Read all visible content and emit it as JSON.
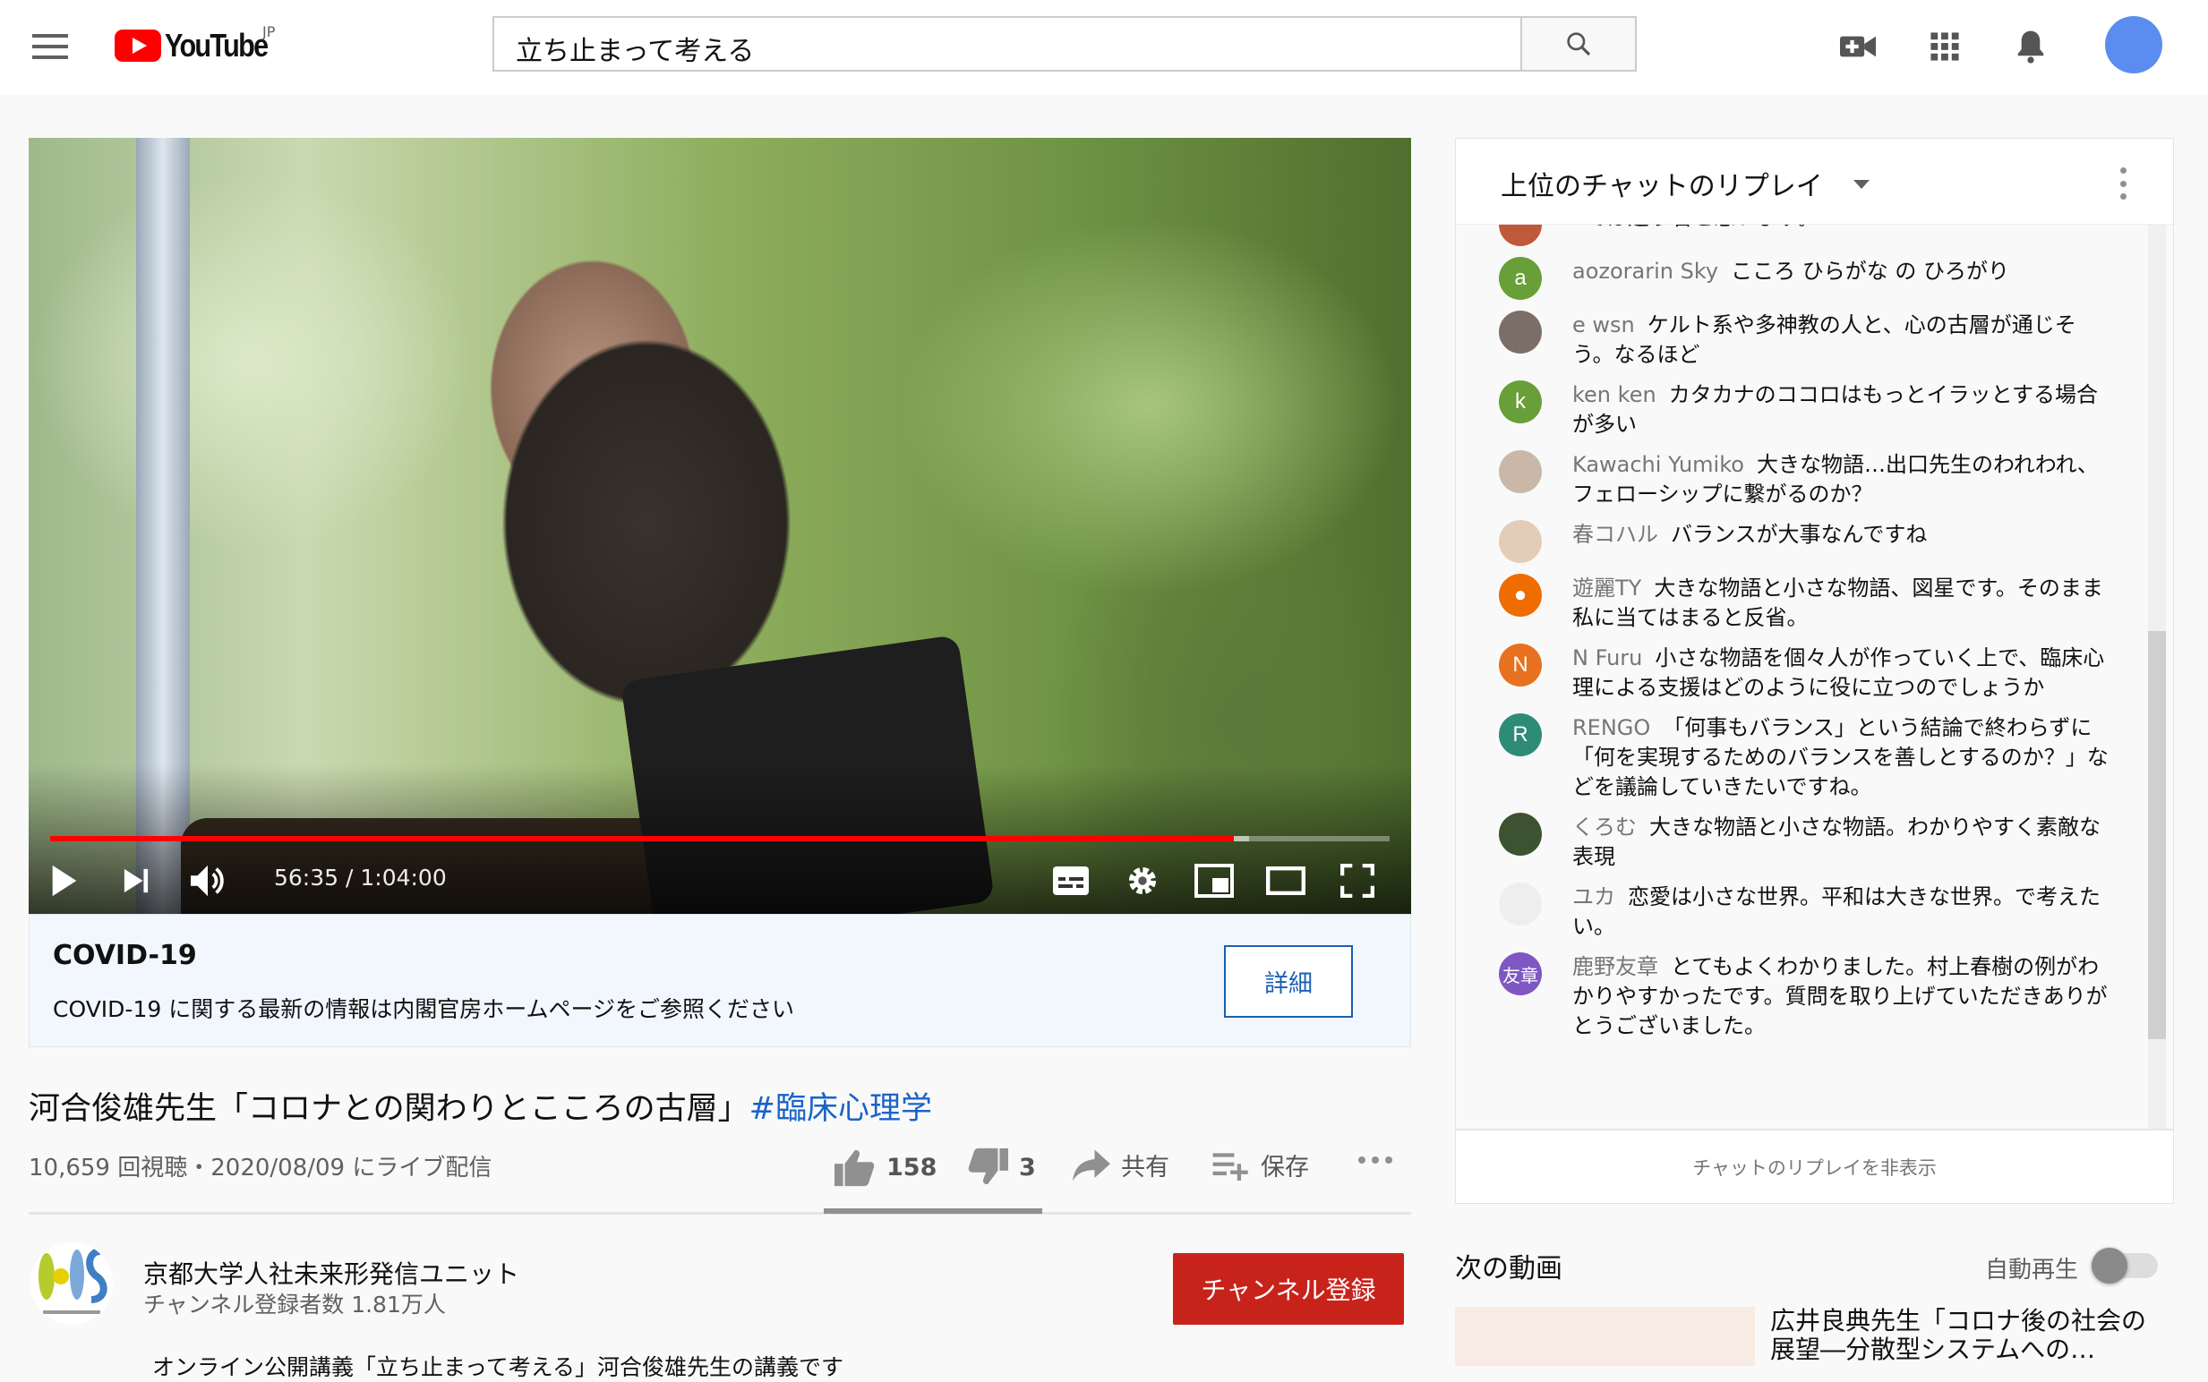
{
  "header": {
    "logo_text": "YouTube",
    "region": "JP",
    "search_value": "立ち止まって考える",
    "icons": [
      "menu-icon",
      "search-icon",
      "create-video-icon",
      "apps-icon",
      "notifications-icon"
    ]
  },
  "player": {
    "current_time": "56:35",
    "duration": "1:04:00",
    "time_display": "56:35 / 1:04:00",
    "progress_fraction": 0.884,
    "buffered_fraction": 0.895,
    "accent": "#ff0000"
  },
  "covid": {
    "title": "COVID-19",
    "text": "COVID-19 に関する最新の情報は内閣官房ホームページをご参照ください",
    "button": "詳細"
  },
  "video": {
    "title": "河合俊雄先生「コロナとの関わりとこころの古層」",
    "hashtag": "#臨床心理学",
    "meta": "10,659 回視聴・2020/08/09 にライブ配信",
    "likes": "158",
    "dislikes": "3",
    "share": "共有",
    "save": "保存"
  },
  "channel": {
    "name": "京都大学人社未来形発信ユニット",
    "subscribers": "チャンネル登録者数 1.81万人",
    "subscribe": "チャンネル登録",
    "description": "オンライン公開講義「立ち止まって考える」河合俊雄先生の講義です"
  },
  "chat": {
    "title": "上位のチャットのリプレイ",
    "hide": "チャットのリプレイを非表示",
    "messages": [
      {
        "author": "",
        "text": "では違う名と思います。",
        "avatar": "",
        "color": "#c0583a"
      },
      {
        "author": "aozorarin Sky",
        "text": "こころ ひらがな の ひろがり",
        "avatar": "a",
        "color": "#689f38"
      },
      {
        "author": "e wsn",
        "text": "ケルト系や多神教の人と、心の古層が通じそう。なるほど",
        "avatar": "",
        "color": "#7a6e66"
      },
      {
        "author": "ken ken",
        "text": "カタカナのココロはもっとイラッとする場合が多い",
        "avatar": "k",
        "color": "#689f38"
      },
      {
        "author": "Kawachi Yumiko",
        "text": "大きな物語…出口先生のわれわれ、フェローシップに繋がるのか？",
        "avatar": "",
        "color": "#c9b8a8"
      },
      {
        "author": "春コハル",
        "text": "バランスが大事なんですね",
        "avatar": "",
        "color": "#e3cdb8"
      },
      {
        "author": "遊麗TY",
        "text": "大きな物語と小さな物語、図星です。そのまま私に当てはまると反省。",
        "avatar": "●",
        "color": "#ef6c00"
      },
      {
        "author": "N Furu",
        "text": "小さな物語を個々人が作っていく上で、臨床心理による支援はどのように役に立つのでしょうか",
        "avatar": "N",
        "color": "#e8711f"
      },
      {
        "author": "RENGO",
        "text": "「何事もバランス」という結論で終わらずに「何を実現するためのバランスを善しとするのか？」などを議論していきたいですね。",
        "avatar": "R",
        "color": "#2e8b78"
      },
      {
        "author": "くろむ",
        "text": "大きな物語と小さな物語。わかりやすく素敵な表現",
        "avatar": "",
        "color": "#3d5231"
      },
      {
        "author": "ユカ",
        "text": "恋愛は小さな世界。平和は大きな世界。で考えたい。",
        "avatar": "",
        "color": "#eeeeee"
      },
      {
        "author": "鹿野友章",
        "text": "とてもよくわかりました。村上春樹の例がわかりやすかったです。質問を取り上げていただきありがとうございました。",
        "avatar": "友章",
        "color": "#7e57c2"
      }
    ]
  },
  "up_next": {
    "label": "次の動画",
    "autoplay": "自動再生",
    "autoplay_on": false,
    "next_title": "広井良典先生「コロナ後の社会の展望―分散型システムへの…"
  }
}
